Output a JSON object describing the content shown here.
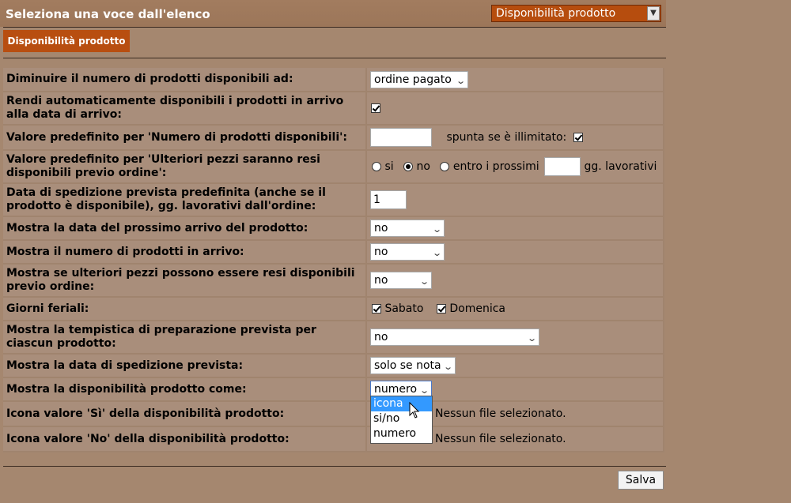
{
  "header": {
    "title": "Seleziona una voce dall'elenco",
    "section_select": "Disponibilità prodotto"
  },
  "tab": {
    "label": "Disponibilità prodotto"
  },
  "rows": {
    "decrease": {
      "label": "Diminuire il numero di prodotti disponibili ad:",
      "value": "ordine pagato"
    },
    "auto_available": {
      "label": "Rendi automaticamente disponibili i prodotti in arrivo alla data di arrivo:",
      "checked": true
    },
    "default_qty": {
      "label": "Valore predefinito per 'Numero di prodotti disponibili':",
      "value": "",
      "unlimited_label": "spunta se è illimitato:",
      "unlimited_checked": true
    },
    "extra_pieces": {
      "label": "Valore predefinito per 'Ulteriori pezzi saranno resi disponibili previo ordine':",
      "opt_si": "si",
      "opt_no": "no",
      "opt_within": "entro i prossimi",
      "days_value": "",
      "days_suffix": "gg. lavorativi",
      "selected": "no"
    },
    "ship_date": {
      "label": "Data di spedizione prevista predefinita (anche se il prodotto è disponibile), gg. lavorativi dall'ordine:",
      "value": "1"
    },
    "next_arrival": {
      "label": "Mostra la data del prossimo arrivo del prodotto:",
      "value": "no"
    },
    "incoming_count": {
      "label": "Mostra il numero di prodotti in arrivo:",
      "value": "no"
    },
    "extra_on_order": {
      "label": "Mostra se ulteriori pezzi possono essere resi disponibili previo ordine:",
      "value": "no"
    },
    "workdays": {
      "label": "Giorni feriali:",
      "sat_label": "Sabato",
      "sat_checked": true,
      "sun_label": "Domenica",
      "sun_checked": true
    },
    "prep_time": {
      "label": "Mostra la tempistica di preparazione prevista per ciascun prodotto:",
      "value": "no"
    },
    "show_ship_date": {
      "label": "Mostra la data di spedizione prevista:",
      "value": "solo se nota"
    },
    "availability_as": {
      "label": "Mostra la disponibilità prodotto come:",
      "value": "numero"
    },
    "icon_yes": {
      "label": "Icona valore 'Sì' della disponibilità prodotto:",
      "file_status": "Nessun file selezionato."
    },
    "icon_no": {
      "label": "Icona valore 'No' della disponibilità prodotto:",
      "file_status": "Nessun file selezionato."
    }
  },
  "dropdown": {
    "options": [
      "icona",
      "si/no",
      "numero"
    ],
    "highlighted": "icona"
  },
  "footer": {
    "save_label": "Salva"
  },
  "colors": {
    "background": "#a5876f",
    "accent": "#b84e10",
    "row_bg": "#a98e7b",
    "highlight": "#3399ff"
  }
}
